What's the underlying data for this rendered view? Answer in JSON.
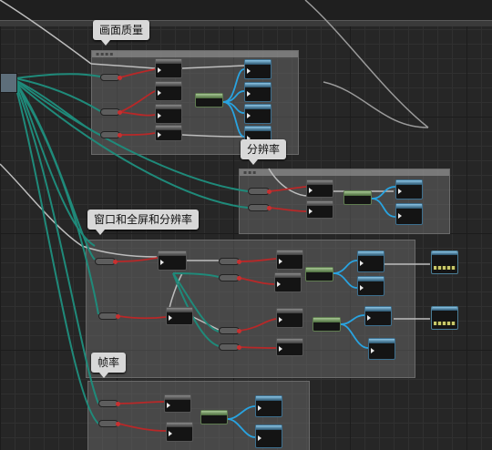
{
  "comments": {
    "quality": "画面质量",
    "resolution": "分辨率",
    "window": "窗口和全屏和分辨率",
    "framerate": "帧率"
  },
  "colors": {
    "exec_wire": "#c8c8c8",
    "var_wire": "#1f8a7a",
    "red_wire": "#b82828",
    "blue_wire": "#29a3e0"
  }
}
